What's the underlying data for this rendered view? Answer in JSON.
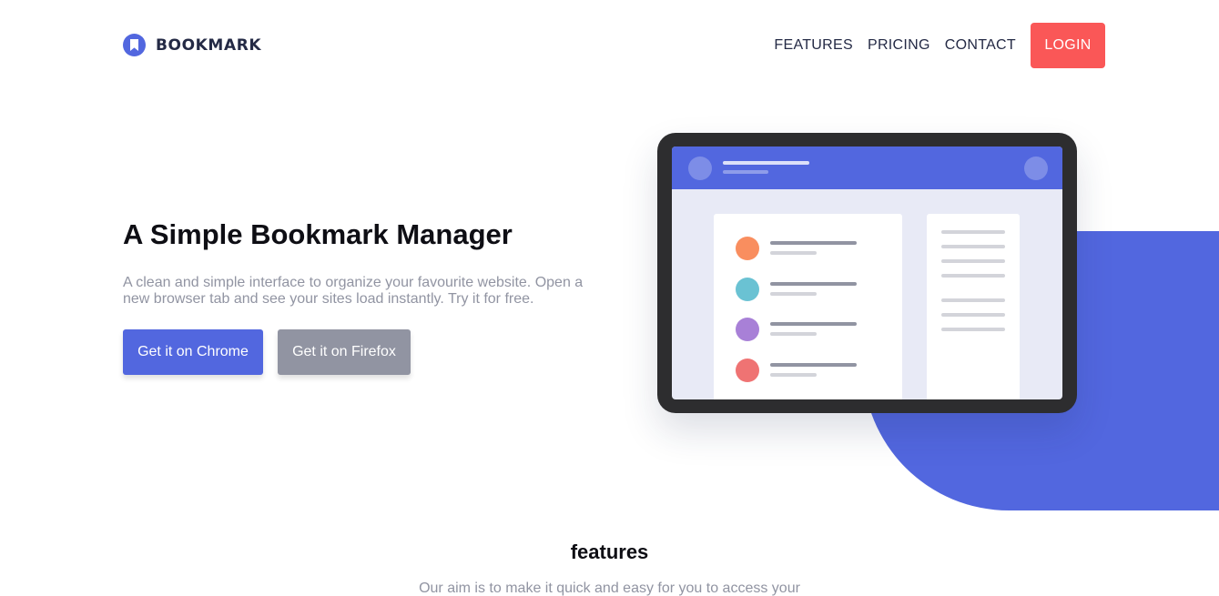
{
  "header": {
    "brand": "BOOKMARK",
    "nav": [
      "FEATURES",
      "PRICING",
      "CONTACT"
    ],
    "login_label": "LOGIN"
  },
  "hero": {
    "title": "A Simple Bookmark Manager",
    "description": "A clean and simple interface to organize your favourite website. Open a new browser tab and see your sites load instantly. Try it for free.",
    "chrome_button": "Get it on Chrome",
    "firefox_button": "Get it on Firefox"
  },
  "features": {
    "title": "features",
    "description": "Our aim is to make it quick and easy for you to access your"
  },
  "colors": {
    "primary": "#5267df",
    "accent_red": "#fa5757",
    "gray": "#9194a2",
    "dark": "#242a45",
    "dots": [
      "#f98e5f",
      "#6ac2d3",
      "#a880d7",
      "#ef7373"
    ]
  },
  "icons": {
    "logo": "bookmark-logo-icon"
  }
}
